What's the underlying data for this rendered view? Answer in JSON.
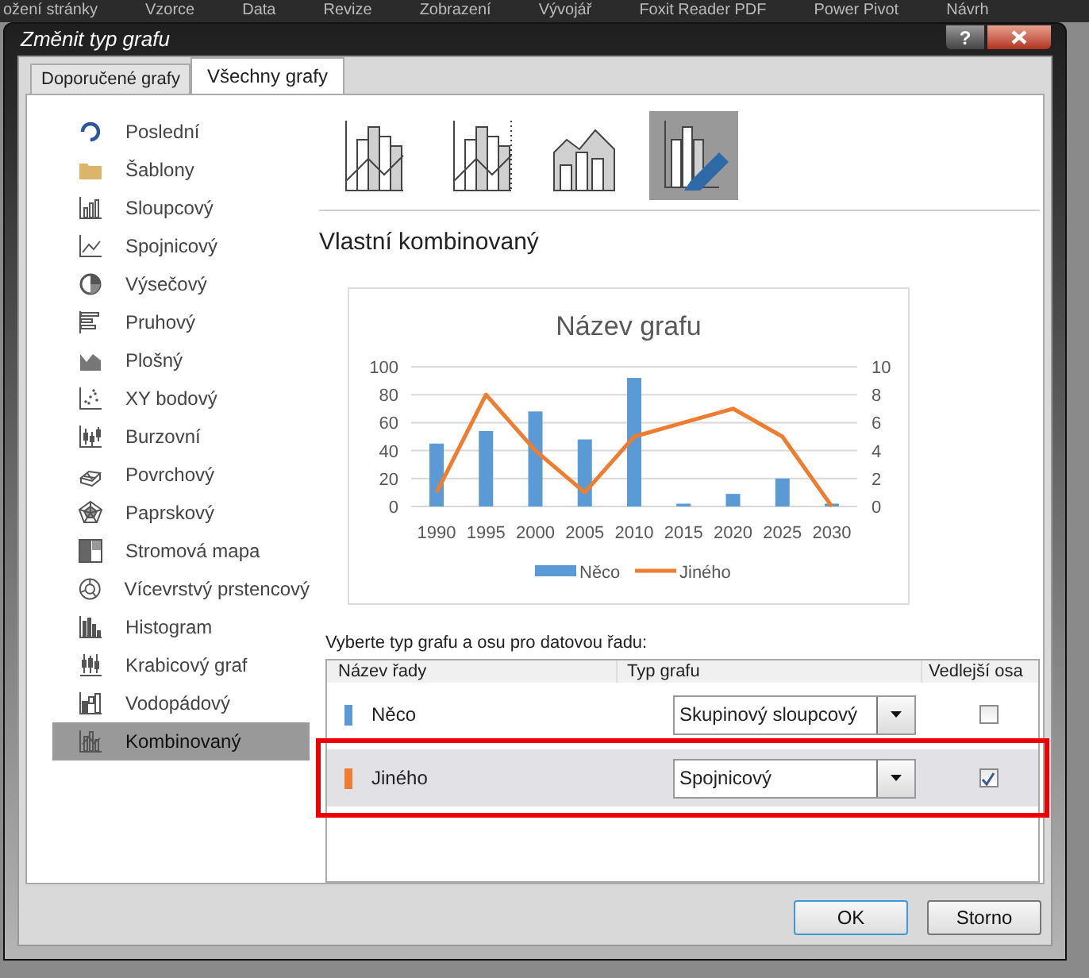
{
  "ribbon_tabs": [
    "ožení stránky",
    "Vzorce",
    "Data",
    "Revize",
    "Zobrazení",
    "Vývojář",
    "Foxit Reader PDF",
    "Power Pivot",
    "Návrh"
  ],
  "window": {
    "title": "Změnit typ grafu",
    "help_button": "?"
  },
  "tabs": [
    {
      "label": "Doporučené grafy",
      "selected": false
    },
    {
      "label": "Všechny grafy",
      "selected": true
    }
  ],
  "sidebar": {
    "items": [
      {
        "label": "Poslední",
        "selected": false
      },
      {
        "label": "Šablony",
        "selected": false
      },
      {
        "label": "Sloupcový",
        "selected": false
      },
      {
        "label": "Spojnicový",
        "selected": false
      },
      {
        "label": "Výsečový",
        "selected": false
      },
      {
        "label": "Pruhový",
        "selected": false
      },
      {
        "label": "Plošný",
        "selected": false
      },
      {
        "label": "XY bodový",
        "selected": false
      },
      {
        "label": "Burzovní",
        "selected": false
      },
      {
        "label": "Povrchový",
        "selected": false
      },
      {
        "label": "Paprskový",
        "selected": false
      },
      {
        "label": "Stromová mapa",
        "selected": false
      },
      {
        "label": "Vícevrstvý prstencový",
        "selected": false
      },
      {
        "label": "Histogram",
        "selected": false
      },
      {
        "label": "Krabicový graf",
        "selected": false
      },
      {
        "label": "Vodopádový",
        "selected": false
      },
      {
        "label": "Kombinovaný",
        "selected": true
      }
    ]
  },
  "subtypes": [
    {
      "selected": false
    },
    {
      "selected": false
    },
    {
      "selected": false
    },
    {
      "selected": true
    }
  ],
  "subtype_title": "Vlastní kombinovaný",
  "preview": {
    "chart_data": {
      "type": "bar",
      "title": "Název grafu",
      "categories": [
        "1990",
        "1995",
        "2000",
        "2005",
        "2010",
        "2015",
        "2020",
        "2025",
        "2030"
      ],
      "ylim": [
        0,
        100
      ],
      "yticks": [
        0,
        20,
        40,
        60,
        80,
        100
      ],
      "y2lim": [
        0,
        10
      ],
      "y2ticks": [
        0,
        2,
        4,
        6,
        8,
        10
      ],
      "grid": "y",
      "legend": "bottom",
      "series": [
        {
          "name": "Něco",
          "color": "#5b9bd5",
          "values": [
            45,
            54,
            68,
            48,
            92,
            2,
            9,
            20,
            2
          ]
        },
        {
          "name": "Jiného",
          "type": "line",
          "axis": "y2",
          "color": "#ed7d31",
          "values": [
            1,
            8,
            4,
            1,
            5,
            6,
            7,
            5,
            0
          ]
        }
      ]
    }
  },
  "series_panel": {
    "label": "Vyberte typ grafu a osu pro datovou řadu:",
    "columns": [
      "Název řady",
      "Typ grafu",
      "Vedlejší osa"
    ],
    "rows": [
      {
        "name": "Něco",
        "color": "#5b9bd5",
        "chart_type": "Skupinový sloupcový",
        "secondary_axis": false,
        "selected": false,
        "highlighted": false
      },
      {
        "name": "Jiného",
        "color": "#ed7d31",
        "chart_type": "Spojnicový",
        "secondary_axis": true,
        "selected": true,
        "highlighted": true
      }
    ]
  },
  "buttons": [
    {
      "label": "OK",
      "default": true
    },
    {
      "label": "Storno",
      "default": false
    }
  ]
}
